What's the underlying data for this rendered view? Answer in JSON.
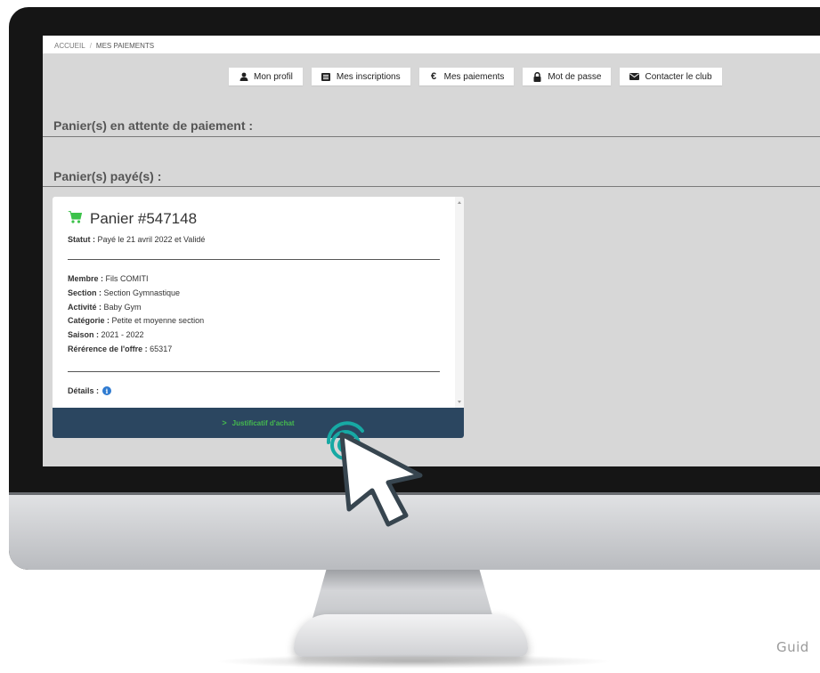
{
  "breadcrumb": {
    "home": "ACCUEIL",
    "separator": "/",
    "current": "MES PAIEMENTS"
  },
  "nav": [
    {
      "label": "Mon profil",
      "icon": "user-icon"
    },
    {
      "label": "Mes inscriptions",
      "icon": "list-icon"
    },
    {
      "label": "Mes paiements",
      "icon": "euro-icon"
    },
    {
      "label": "Mot de passe",
      "icon": "lock-icon"
    },
    {
      "label": "Contacter le club",
      "icon": "envelope-icon"
    }
  ],
  "sections": {
    "pending_title": "Panier(s) en attente de paiement :",
    "paid_title": "Panier(s) payé(s) :"
  },
  "card": {
    "icon": "cart-icon",
    "title": "Panier #547148",
    "status_label": "Statut :",
    "status_value": " Payé le 21 avril 2022 et Validé",
    "fields": [
      {
        "label": "Membre :",
        "value": " Fils COMITI"
      },
      {
        "label": "Section :",
        "value": " Section Gymnastique"
      },
      {
        "label": "Activité :",
        "value": " Baby Gym"
      },
      {
        "label": "Catégorie :",
        "value": " Petite et moyenne section"
      },
      {
        "label": "Saison :",
        "value": " 2021 - 2022"
      },
      {
        "label": "Rérérence de l'offre :",
        "value": " 65317"
      }
    ],
    "details_label": "Détails :",
    "details_icon": "info-icon",
    "footer_chevron": ">",
    "footer_label": "Justificatif d'achat"
  },
  "watermark": "Guid",
  "colors": {
    "screen_bg": "#d7d7d7",
    "footer_bg": "#2b4660",
    "footer_text": "#45b94e",
    "cart_icon": "#3cc24a",
    "info_icon": "#2f7bd1",
    "click_ring": "#17a9a4"
  }
}
